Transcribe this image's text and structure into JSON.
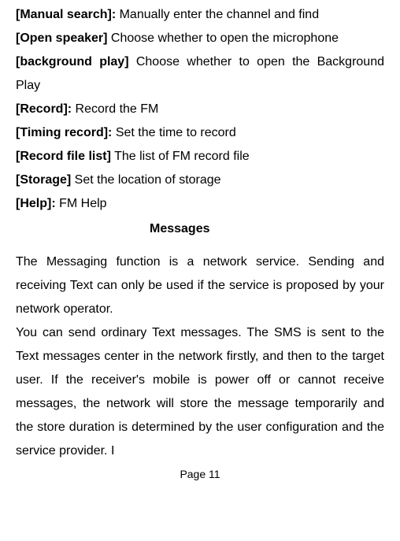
{
  "items": [
    {
      "label": "[Manual search]:",
      "desc": " Manually enter the channel and find",
      "justify": false
    },
    {
      "label": "[Open speaker]",
      "desc": " Choose whether to open the microphone",
      "justify": false
    },
    {
      "label": "[background play]",
      "desc": " Choose whether to open the Background Play",
      "justify": true
    },
    {
      "label": "[Record]:",
      "desc": " Record the FM",
      "justify": false
    },
    {
      "label": "[Timing record]:",
      "desc": " Set the time to record",
      "justify": false
    },
    {
      "label": "[Record file list]",
      "desc": "   The list of FM record file",
      "justify": false
    },
    {
      "label": "[Storage]",
      "desc": " Set the location of storage",
      "justify": false
    },
    {
      "label": "[Help]:",
      "desc": " FM Help",
      "justify": false
    }
  ],
  "heading": "Messages",
  "para1": "The Messaging function is a network service. Sending and receiving Text can only be used if the service is proposed by your network operator.",
  "para2": "You can send ordinary Text messages. The SMS is sent to the Text messages center in the network firstly, and then to the target user. If the receiver's mobile is power off or cannot receive messages, the network will store the message temporarily and the store duration is determined by the user configuration and the service provider. I",
  "footer": "Page 11"
}
